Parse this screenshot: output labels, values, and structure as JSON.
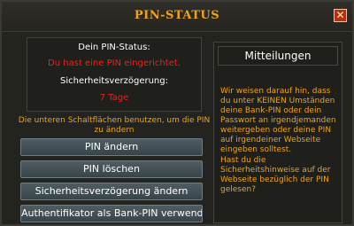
{
  "window": {
    "title": "PIN-STATUS",
    "close_symbol": "✕"
  },
  "status": {
    "pin_label": "Dein PIN-Status:",
    "pin_value": "Du hast eine PIN eingerichtet.",
    "delay_label": "Sicherheitsverzögerung:",
    "delay_value": "7 Tage"
  },
  "instruction": "Die unteren Schaltflächen benutzen, um die PIN zu ändern",
  "buttons": [
    {
      "label": "PIN ändern"
    },
    {
      "label": "PIN löschen"
    },
    {
      "label": "Sicherheitsverzögerung ändern"
    },
    {
      "label": "Authentifikator als Bank-PIN verwenden"
    }
  ],
  "messages": {
    "header": "Mitteilungen",
    "paragraph1": "Wir weisen darauf hin, dass du unter KEINEN Umständen deine Bank-PIN oder dein Passwort an irgendjemanden weitergeben oder deine PIN auf irgendeiner Webseite eingeben solltest.",
    "paragraph2": "Hast du die Sicherheitshinweise auf der Webseite bezüglich der PIN gelesen?"
  },
  "colors": {
    "title": "#f0a317",
    "alert": "#e8221f",
    "info": "#f0a317"
  }
}
